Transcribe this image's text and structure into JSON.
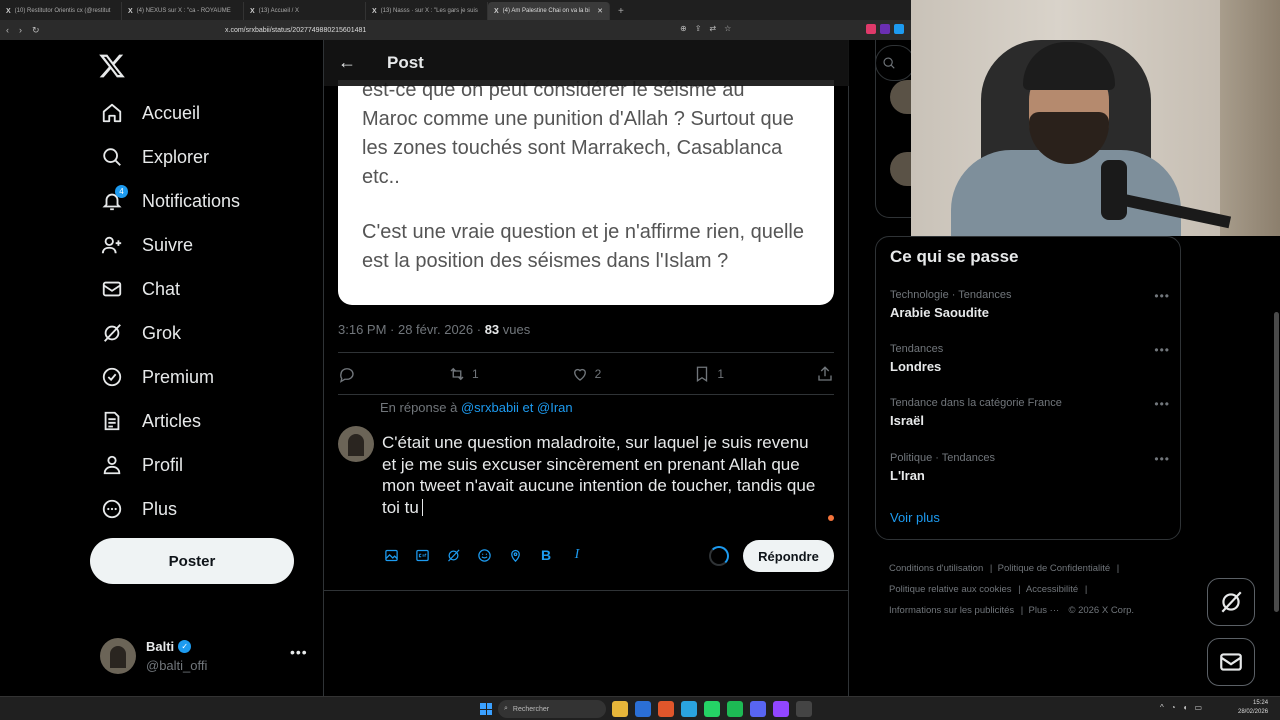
{
  "browser": {
    "tabs": [
      {
        "label": "(10) Restitutor Orientis cx (@restitut",
        "active": false
      },
      {
        "label": "(4) NEXUS sur X : \"ca - ROYAUME",
        "active": false
      },
      {
        "label": "(13) Accueil / X",
        "active": false
      },
      {
        "label": "(13) Nasss · sur X : \"Les gars je suis",
        "active": false
      },
      {
        "label": "(4) Am Palestine Chai on va la bi",
        "active": true
      }
    ],
    "url": "x.com/srxbabii/status/2027749880215601481"
  },
  "sidebar": {
    "items": [
      {
        "label": "Accueil",
        "icon": "home-icon"
      },
      {
        "label": "Explorer",
        "icon": "search-icon"
      },
      {
        "label": "Notifications",
        "icon": "bell-icon",
        "badge": "4"
      },
      {
        "label": "Suivre",
        "icon": "follow-icon"
      },
      {
        "label": "Chat",
        "icon": "mail-icon"
      },
      {
        "label": "Grok",
        "icon": "grok-icon"
      },
      {
        "label": "Premium",
        "icon": "premium-icon"
      },
      {
        "label": "Articles",
        "icon": "articles-icon"
      },
      {
        "label": "Profil",
        "icon": "profile-icon"
      },
      {
        "label": "Plus",
        "icon": "more-icon"
      }
    ],
    "post_button": "Poster",
    "account": {
      "name": "Balti",
      "handle": "@balti_offi"
    }
  },
  "main": {
    "title": "Post",
    "image_text": {
      "line0": "est-ce que on peut considérer le séisme au",
      "para1": "Maroc comme une punition d'Allah ? Surtout que les zones touchés sont Marrakech, Casablanca etc..",
      "para2": "C'est une vraie question et je n'affirme rien, quelle est la position des séismes dans l'Islam ?"
    },
    "meta": {
      "time": "3:16 PM · 28 févr. 2026 · ",
      "views": "83",
      "views_label": " vues"
    },
    "stats": {
      "reposts": "1",
      "likes": "2",
      "bookmarks": "1"
    },
    "reply_to": {
      "prefix": "En réponse à ",
      "users": "@srxbabii et @Iran"
    },
    "reply_text": "C'était une question maladroite, sur laquel je suis revenu et je me suis excuser sincèrement en prenant Allah que mon tweet n'avait aucune intention de toucher, tandis que toi tu",
    "reply_button": "Répondre"
  },
  "trends": {
    "title": "Ce qui se passe",
    "items": [
      {
        "context": "Technologie · Tendances",
        "name": "Arabie Saoudite"
      },
      {
        "context": "Tendances",
        "name": "Londres"
      },
      {
        "context": "Tendance dans la catégorie France",
        "name": "Israël"
      },
      {
        "context": "Politique · Tendances",
        "name": "L'Iran"
      }
    ],
    "see_more": "Voir plus"
  },
  "footer": {
    "l1": "Conditions d'utilisation",
    "l2": "Politique de Confidentialité",
    "l3": "Politique relative aux cookies",
    "l4": "Accessibilité",
    "l5": "Informations sur les publicités",
    "l6": "Plus ···",
    "l7": "© 2026 X Corp."
  },
  "taskbar": {
    "search": "Rechercher",
    "time": "15:24",
    "date": "28/02/2026"
  },
  "colors": {
    "accent": "#1d9bf0",
    "background": "#000000",
    "muted": "#71767b",
    "text": "#e7e9ea"
  }
}
